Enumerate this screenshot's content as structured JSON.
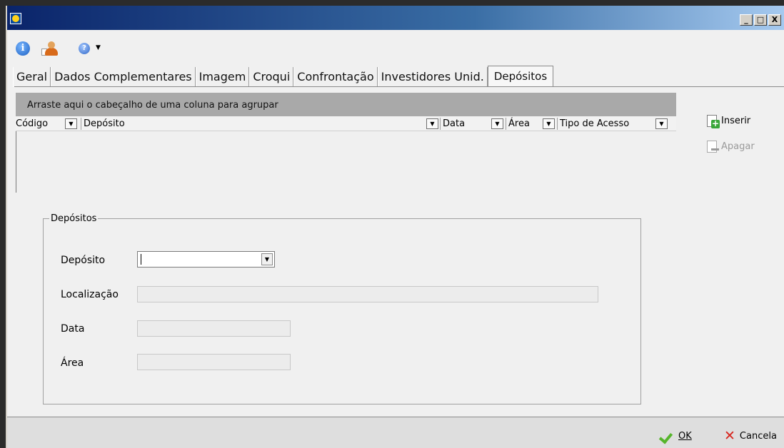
{
  "window": {
    "minimize": "_",
    "maximize": "□",
    "close": "X"
  },
  "toolbar": {
    "info_glyph": "i",
    "help_glyph": "?",
    "dropdown_glyph": "▼"
  },
  "tabs": [
    "Geral",
    "Dados Complementares",
    "Imagem",
    "Croqui",
    "Confrontação",
    "Investidores Unid.",
    "Depósitos"
  ],
  "active_tab": "Depósitos",
  "grid": {
    "group_hint": "Arraste aqui o cabeçalho de uma coluna para agrupar",
    "columns": [
      "Código",
      "Depósito",
      "Data",
      "Área",
      "Tipo de Acesso"
    ],
    "dropdown_glyph": "▼"
  },
  "actions": {
    "insert": "Inserir",
    "delete": "Apagar"
  },
  "form": {
    "legend": "Depósitos",
    "deposito_label": "Depósito",
    "deposito_value": "",
    "localizacao_label": "Localização",
    "data_label": "Data",
    "area_label": "Área",
    "combo_glyph": "▼"
  },
  "footer": {
    "ok": "OK",
    "cancel": "Cancela"
  }
}
